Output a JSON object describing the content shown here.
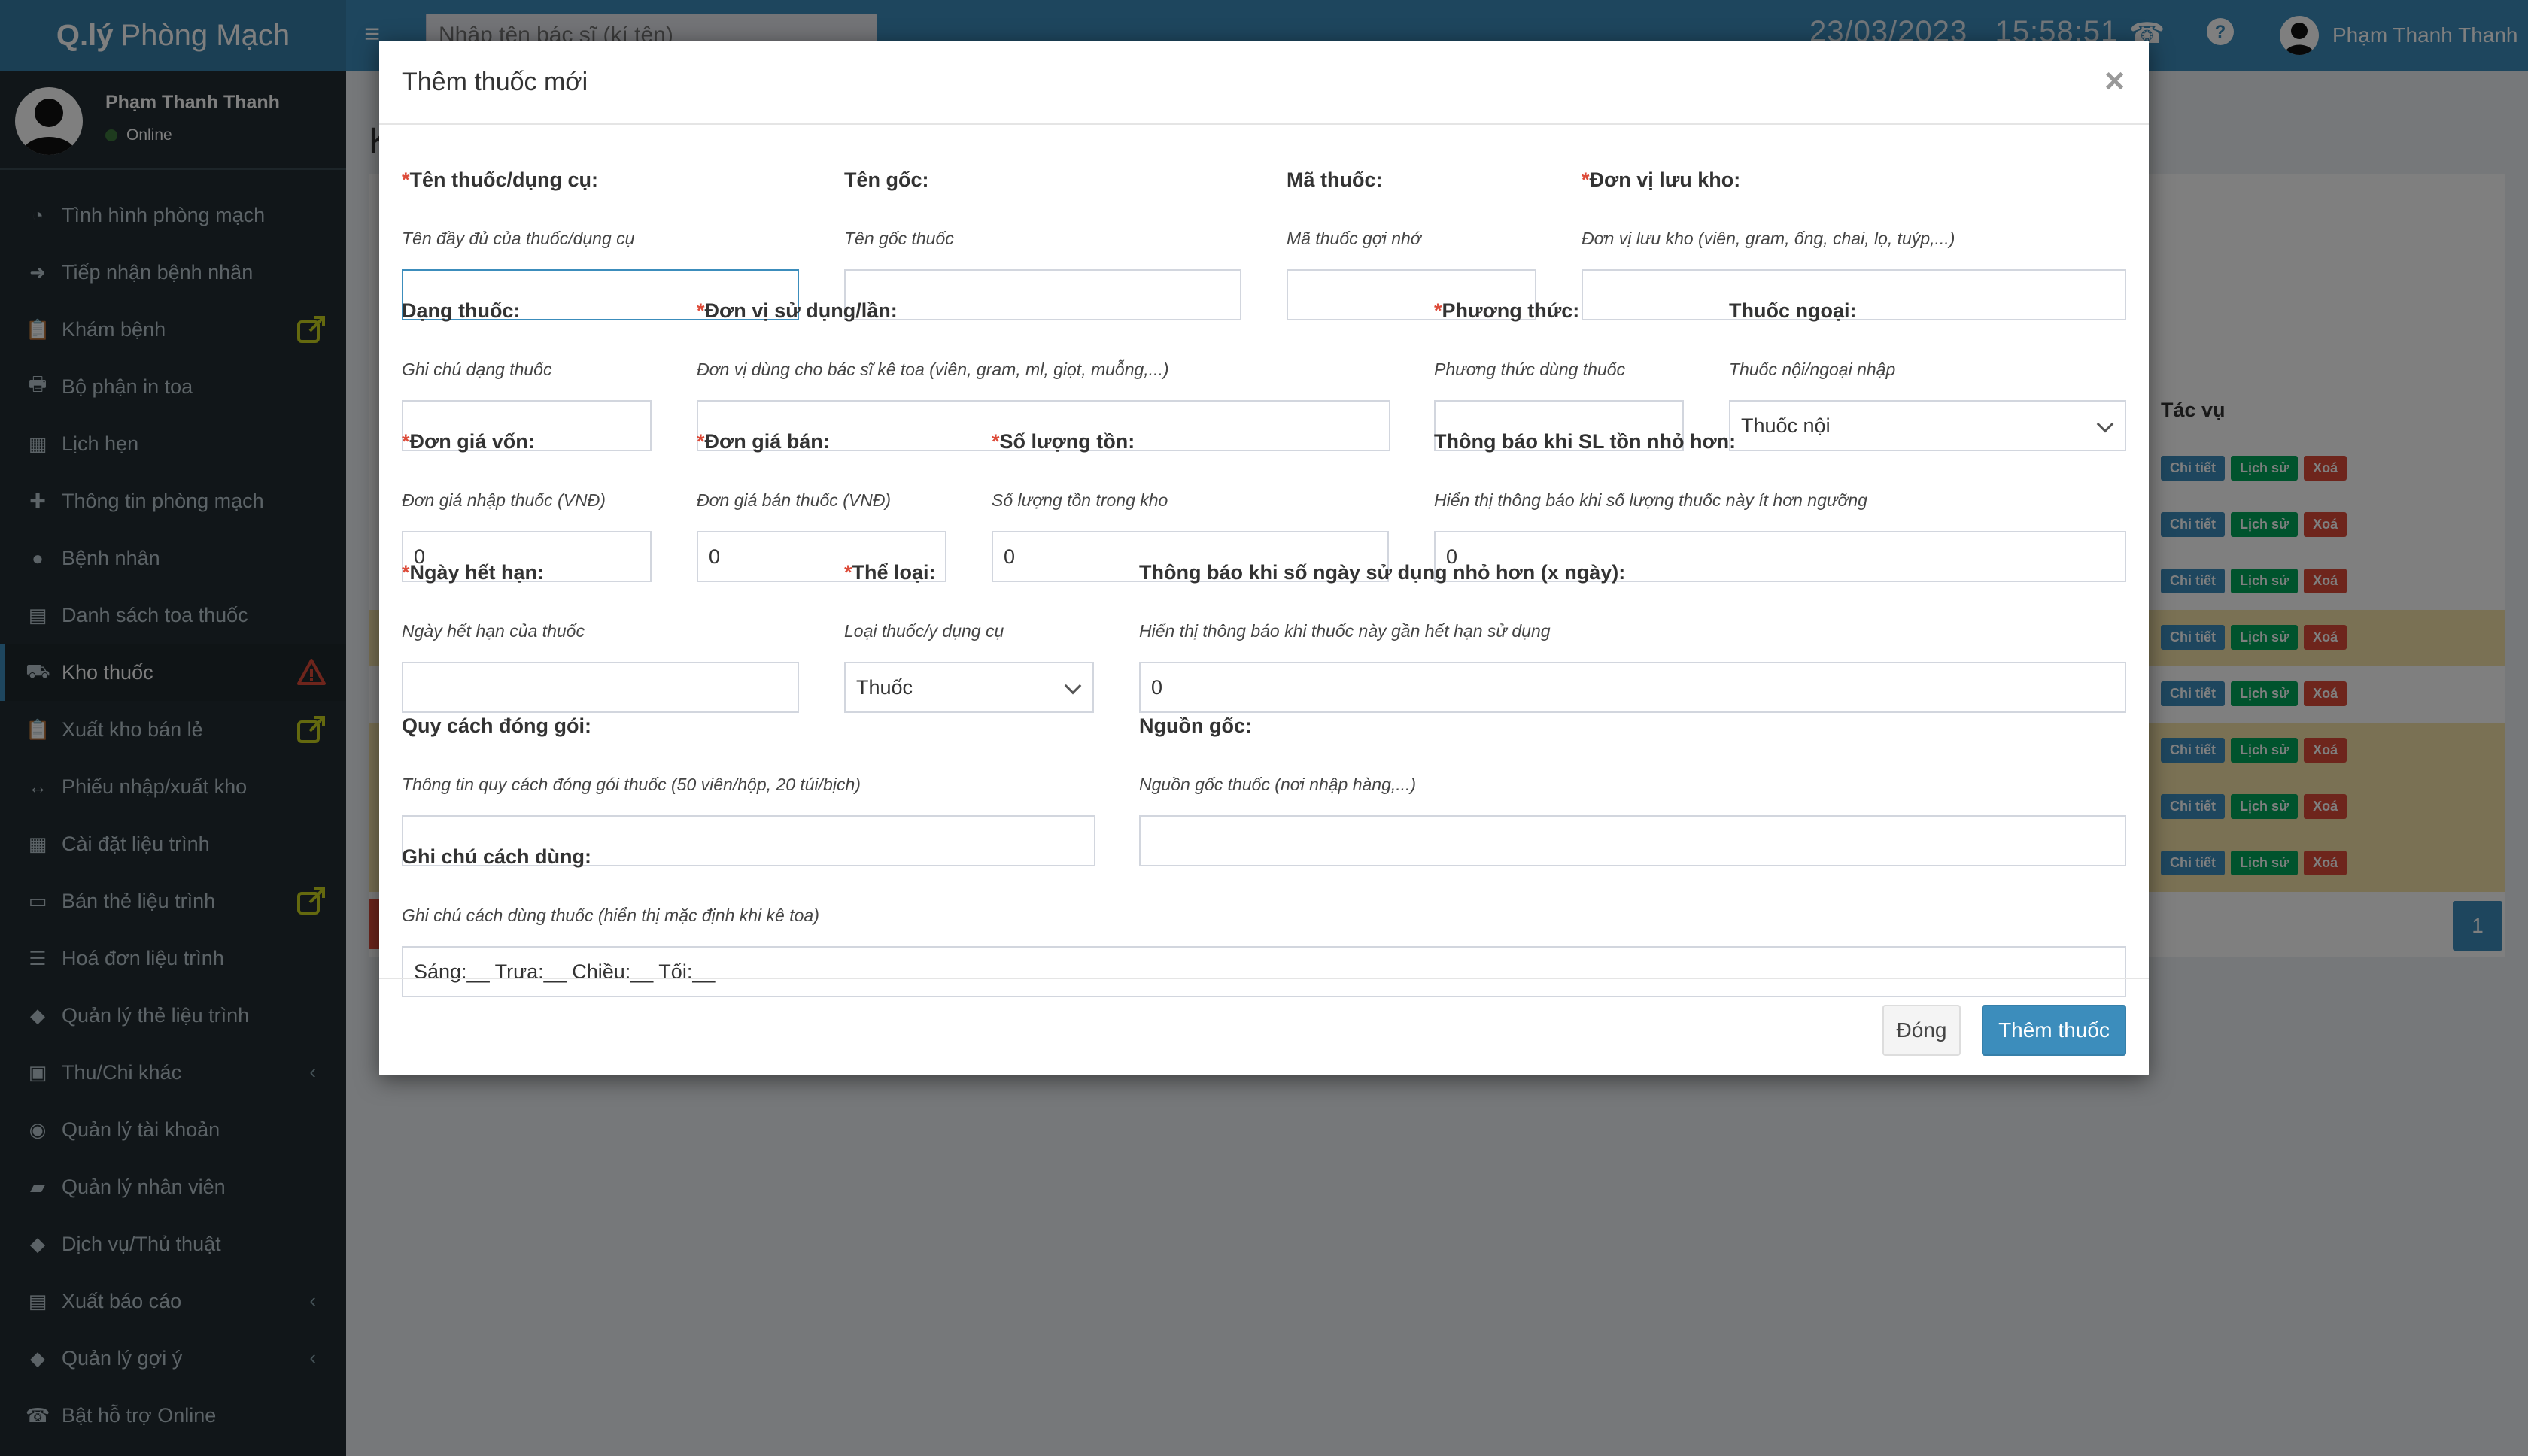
{
  "header": {
    "logo_bold": "Q.lý",
    "logo_rest": "Phòng Mạch",
    "doctor_search_placeholder": "Nhập tên bác sĩ (kí tên)",
    "date": "23/03/2023",
    "time": "15:58:51",
    "user_name": "Phạm Thanh Thanh"
  },
  "sidebar": {
    "user_name": "Phạm Thanh Thanh",
    "status": "Online",
    "items": [
      {
        "label": "Tình hình phòng mạch",
        "icon": "dashboard-icon"
      },
      {
        "label": "Tiếp nhận bệnh nhân",
        "icon": "sign-in-icon"
      },
      {
        "label": "Khám bệnh",
        "icon": "clipboard-icon",
        "badge": "external-link-icon"
      },
      {
        "label": "Bộ phận in toa",
        "icon": "print-icon"
      },
      {
        "label": "Lịch hẹn",
        "icon": "calendar-icon"
      },
      {
        "label": "Thông tin phòng mạch",
        "icon": "plus-icon"
      },
      {
        "label": "Bệnh nhân",
        "icon": "user-icon"
      },
      {
        "label": "Danh sách toa thuốc",
        "icon": "file-icon"
      },
      {
        "label": "Kho thuốc",
        "icon": "ambulance-icon",
        "badge": "warning-icon",
        "active": true
      },
      {
        "label": "Xuất kho bán lẻ",
        "icon": "clipboard-icon",
        "badge": "external-link-icon"
      },
      {
        "label": "Phiếu nhập/xuất kho",
        "icon": "arrows-h-icon"
      },
      {
        "label": "Cài đặt liệu trình",
        "icon": "table-icon"
      },
      {
        "label": "Bán thẻ liệu trình",
        "icon": "credit-card-icon",
        "badge": "external-link-icon"
      },
      {
        "label": "Hoá đơn liệu trình",
        "icon": "list-icon"
      },
      {
        "label": "Quản lý thẻ liệu trình",
        "icon": "tags-icon"
      },
      {
        "label": "Thu/Chi khác",
        "icon": "money-icon",
        "caret": true
      },
      {
        "label": "Quản lý tài khoản",
        "icon": "users-icon"
      },
      {
        "label": "Quản lý nhân viên",
        "icon": "briefcase-icon"
      },
      {
        "label": "Dịch vụ/Thủ thuật",
        "icon": "tags-icon"
      },
      {
        "label": "Xuất báo cáo",
        "icon": "excel-icon",
        "caret": true
      },
      {
        "label": "Quản lý gợi ý",
        "icon": "tags-icon",
        "caret": true
      },
      {
        "label": "Bật hỗ trợ Online",
        "icon": "phone-icon"
      }
    ]
  },
  "background": {
    "title_initial": "K",
    "actions_header": "Tác vụ",
    "row_actions": [
      "Chi tiết",
      "Lịch sử",
      "Xoá"
    ],
    "page_number": "1"
  },
  "modal": {
    "title": "Thêm thuốc mới",
    "close": "×",
    "fields": {
      "ten_thuoc": {
        "label": "Tên thuốc/dụng cụ:",
        "required": true,
        "hint": "Tên đầy đủ của thuốc/dụng cụ",
        "value": ""
      },
      "ten_goc": {
        "label": "Tên gốc:",
        "hint": "Tên gốc thuốc",
        "value": ""
      },
      "ma_thuoc": {
        "label": "Mã thuốc:",
        "hint": "Mã thuốc gợi nhớ",
        "value": ""
      },
      "don_vi_luu_kho": {
        "label": "Đơn vị lưu kho:",
        "required": true,
        "hint": "Đơn vị lưu kho (viên, gram, ống, chai, lọ, tuýp,...)",
        "value": ""
      },
      "dang_thuoc": {
        "label": "Dạng thuốc:",
        "hint": "Ghi chú dạng thuốc",
        "value": ""
      },
      "don_vi_su_dung": {
        "label": "Đơn vị sử dụng/lần:",
        "required": true,
        "hint": "Đơn vị dùng cho bác sĩ kê toa (viên, gram, ml, giọt, muỗng,...)",
        "value": ""
      },
      "phuong_thuc": {
        "label": "Phương thức:",
        "required": true,
        "hint": "Phương thức dùng thuốc",
        "value": ""
      },
      "thuoc_ngoai": {
        "label": "Thuốc ngoại:",
        "hint": "Thuốc nội/ngoại nhập",
        "value": "Thuốc nội"
      },
      "don_gia_von": {
        "label": "Đơn giá vốn:",
        "required": true,
        "hint": "Đơn giá nhập thuốc (VNĐ)",
        "value": "0"
      },
      "don_gia_ban": {
        "label": "Đơn giá bán:",
        "required": true,
        "hint": "Đơn giá bán thuốc (VNĐ)",
        "value": "0"
      },
      "so_luong_ton": {
        "label": "Số lượng tồn:",
        "required": true,
        "hint": "Số lượng tồn trong kho",
        "value": "0"
      },
      "thong_bao_sl": {
        "label": "Thông báo khi SL tồn nhỏ hơn:",
        "hint": "Hiển thị thông báo khi số lượng thuốc này ít hơn ngưỡng",
        "value": "0"
      },
      "ngay_het_han": {
        "label": "Ngày hết hạn:",
        "required": true,
        "hint": "Ngày hết hạn của thuốc",
        "value": ""
      },
      "the_loai": {
        "label": "Thể loại:",
        "required": true,
        "hint": "Loại thuốc/y dụng cụ",
        "value": "Thuốc"
      },
      "thong_bao_ngay": {
        "label": "Thông báo khi số ngày sử dụng nhỏ hơn (x ngày):",
        "hint": "Hiển thị thông báo khi thuốc này gần hết hạn sử dụng",
        "value": "0"
      },
      "quy_cach": {
        "label": "Quy cách đóng gói:",
        "hint": "Thông tin quy cách đóng gói thuốc (50 viên/hộp, 20 túi/bịch)",
        "value": ""
      },
      "nguon_goc": {
        "label": "Nguồn gốc:",
        "hint": "Nguồn gốc thuốc (nơi nhập hàng,...)",
        "value": ""
      },
      "ghi_chu": {
        "label": "Ghi chú cách dùng:",
        "hint": "Ghi chú cách dùng thuốc (hiển thị mặc định khi kê toa)",
        "value": "Sáng:__ Trưa:__ Chiều:__ Tối:__"
      }
    },
    "buttons": {
      "close": "Đóng",
      "submit": "Thêm thuốc"
    }
  },
  "colors": {
    "primary": "#3c8dbc",
    "sidebar": "#222d32",
    "danger": "#dd4b39",
    "success": "#00a65a",
    "warning_badge": "#c8d21e"
  }
}
